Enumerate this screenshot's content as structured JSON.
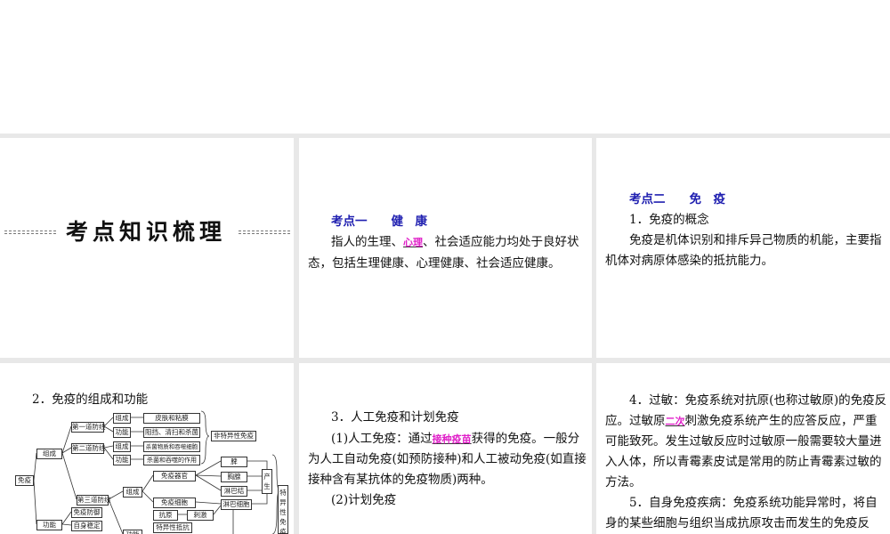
{
  "slide1": {
    "title": "考点知识梳理"
  },
  "slide2": {
    "heading": "考点一　　健　康",
    "line1_pre": "指人的生理、",
    "line1_hl": "心理",
    "line1_post": "、社会适应能力均处于良好状",
    "line2": "态，包括生理健康、心理健康、社会适应健康。"
  },
  "slide3": {
    "heading": "考点二　　免　疫",
    "sub": "1．免疫的概念",
    "line1": "免疫是机体识别和排斥异己物质的机能，主要指",
    "line2": "机体对病原体感染的抵抗能力。"
  },
  "slide4": {
    "heading": "2．免疫的组成和功能",
    "diagram": {
      "root": "免疫",
      "composition": "组成",
      "function": "功能",
      "line1": "第一道防线",
      "line2": "第二道防线",
      "line3": "第三道防线",
      "c1": "组成",
      "f1": "功能",
      "c2": "组成",
      "f2": "功能",
      "skin": "皮肤和粘膜",
      "block": "阻挡、清扫和杀菌",
      "bactericidal": "杀菌物质和吞噬细胞",
      "phago": "杀菌和吞噬的作用",
      "nonspecific": "非特异性免疫",
      "c3": "组成",
      "organ": "免疫器官",
      "cell": "免疫细胞",
      "spleen": "脾",
      "thymus": "胸腺",
      "lymphnode": "淋巴结",
      "lymphocyte": "淋巴细胞",
      "produce": "产生",
      "specific": "特异性免疫",
      "defense": "免疫防御",
      "stability": "自身稳定",
      "f3": "功能",
      "antigen": "抗原",
      "stimulate": "刺激",
      "resist": "特异性抵抗"
    }
  },
  "slide5": {
    "sub": "3．人工免疫和计划免疫",
    "l1_pre": "(1)人工免疫：通过",
    "l1_hl": "接种疫苗",
    "l1_post": "获得的免疫。一般分",
    "l2": "为人工自动免疫(如预防接种)和人工被动免疫(如直接",
    "l3": "接种含有某抗体的免疫物质)两种。",
    "l4": "(2)计划免疫"
  },
  "slide6": {
    "l1": "4．过敏：免疫系统对抗原(也称过敏原)的免疫反",
    "l2_pre": "应。过敏原",
    "l2_hl": "二次",
    "l2_post": "刺激免疫系统产生的应答反应，严重",
    "l3": "可能致死。发生过敏反应时过敏原一般需要较大量进",
    "l4": "入人体，所以青霉素皮试是常用的防止青霉素过敏的",
    "l5": "方法。",
    "l6": "5．自身免疫疾病：免疫系统功能异常时，将自",
    "l7": "身的某些细胞与组织当成抗原攻击而发生的免疫反"
  }
}
